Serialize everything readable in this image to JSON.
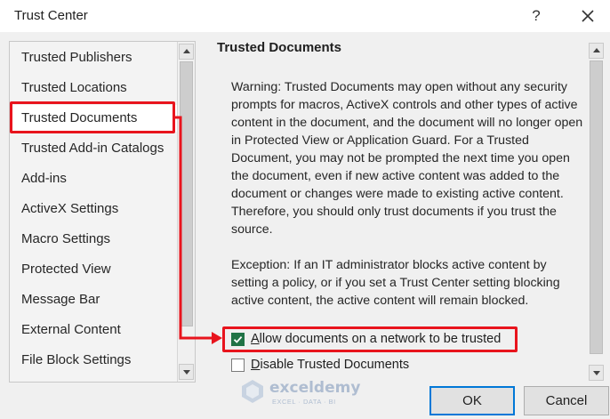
{
  "window": {
    "title": "Trust Center",
    "help_label": "?"
  },
  "nav": {
    "items": [
      {
        "label": "Trusted Publishers"
      },
      {
        "label": "Trusted Locations"
      },
      {
        "label": "Trusted Documents",
        "selected": true
      },
      {
        "label": "Trusted Add-in Catalogs"
      },
      {
        "label": "Add-ins"
      },
      {
        "label": "ActiveX Settings"
      },
      {
        "label": "Macro Settings"
      },
      {
        "label": "Protected View"
      },
      {
        "label": "Message Bar"
      },
      {
        "label": "External Content"
      },
      {
        "label": "File Block Settings"
      }
    ]
  },
  "section": {
    "title": "Trusted Documents",
    "warning_text": "Warning: Trusted Documents may open without any security prompts for macros, ActiveX controls and other types of active content in the document, and the document will no longer open in Protected View or Application Guard. For a Trusted Document, you may not be prompted the next time you open the document, even if new active content was added to the document or changes were made to existing active content. Therefore, you should only trust documents if you trust the source.",
    "exception_text": "Exception: If an IT administrator blocks active content by setting a policy, or if you set a Trust Center setting blocking active content, the active content will remain blocked."
  },
  "options": {
    "allow_network": {
      "label_first": "A",
      "label_rest": "llow documents on a network to be trusted",
      "checked": true
    },
    "disable_trusted": {
      "label_first": "D",
      "label_rest": "isable Trusted Documents",
      "checked": false
    }
  },
  "buttons": {
    "ok": "OK",
    "cancel": "Cancel"
  },
  "watermark": {
    "name": "exceldemy",
    "tagline": "EXCEL · DATA · BI"
  },
  "colors": {
    "annotation_red": "#e8141d",
    "checkbox_green": "#217346",
    "focus_blue": "#0078d7"
  }
}
